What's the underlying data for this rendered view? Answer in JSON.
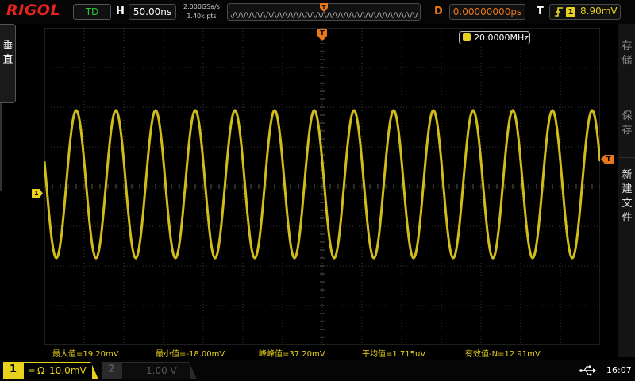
{
  "brand": "RIGOL",
  "top": {
    "run_state": "TD",
    "h_label": "H",
    "timebase": "50.00ns",
    "sample_rate": "2.000GSa/s",
    "mem_depth": "1.40k pts",
    "d_label": "D",
    "delay": "0.00000000ps",
    "t_label": "T",
    "trigger_edge_icon": "rising-edge-icon",
    "trigger_source": "1",
    "trigger_level": "8.90mV"
  },
  "side_left": {
    "vertical": "垂直"
  },
  "side_right": {
    "store": "存储",
    "save": "保存",
    "new_file": "新建文件"
  },
  "screen": {
    "frequency": "20.0000MHz",
    "ch1_marker": "1",
    "trigger_marker": "T"
  },
  "measurements": [
    "最大值=19.20mV",
    "最小值=-18.00mV",
    "峰峰值=37.20mV",
    "平均值=1.715uV",
    "有效值-N=12.91mV"
  ],
  "bottom": {
    "ch1_num": "1",
    "ch1_coupling": "═ Ω",
    "ch1_scale": "10.0mV",
    "ch2_num": "2",
    "ch2_scale": "1.00 V",
    "usb_icon": "usb-icon",
    "time": "16:07"
  },
  "colors": {
    "ch1": "#e8d21c",
    "trigger": "#e8771c",
    "brand": "#e7231d",
    "run_state": "#2ec43a",
    "grid": "#3a3a3a"
  },
  "waveform": {
    "channel": 1,
    "frequency_hz": 20000000,
    "max_mv": 19.2,
    "min_mv": -18.0,
    "scale_mv_per_div": 10.0,
    "timebase_ns_per_div": 50.0
  }
}
